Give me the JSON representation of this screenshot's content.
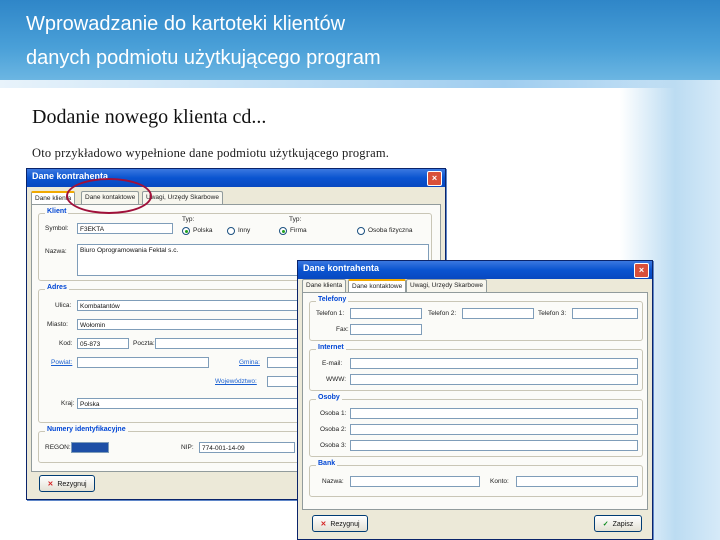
{
  "slide": {
    "title_line1": "Wprowadzanie do kartoteki klientów",
    "title_line2": "danych podmiotu użytkującego program",
    "subheading": "Dodanie nowego klienta cd...",
    "caption": "Oto przykładowo wypełnione dane podmiotu użytkującego program."
  },
  "colors": {
    "header_blue": "#2f86c8",
    "titlebar_blue": "#0a54d0",
    "highlight": "#a0103a",
    "group_label": "#0046d5"
  },
  "window_back": {
    "title": "Dane kontrahenta",
    "close_icon": "×",
    "tabs": [
      "Dane klienta",
      "Dane kontaktowe",
      "Uwagi, Urzędy Skarbowe"
    ],
    "group_klient": {
      "label": "Klient",
      "symbol_label": "Symbol:",
      "symbol_value": "F3EKTA",
      "typ_label": "Typ:",
      "typ_options": [
        "Polska",
        "Inny"
      ],
      "typ2_label": "Typ:",
      "typ2_options": [
        "Firma",
        "Osoba fizyczna"
      ],
      "nazwa_label": "Nazwa:",
      "nazwa_value": "Biuro Oprogramowania Fektal s.c."
    },
    "group_adres": {
      "label": "Adres",
      "ulica_label": "Ulica:",
      "ulica_value": "Kombatantów",
      "miasto_label": "Miasto:",
      "miasto_value": "Wołomin",
      "kod_label": "Kod:",
      "kod_value": "05-873",
      "poczta_label": "Poczta:",
      "powiat_label": "Powiat:",
      "gmina_label": "Gmina:",
      "wojewodztwo_label": "Województwo:",
      "kraj_label": "Kraj:",
      "kraj_value": "Polska"
    },
    "group_numery": {
      "label": "Numery identyfikacyjne",
      "regon_label": "REGON:",
      "nip_label": "NIP:",
      "nip_value": "774-001-14-09"
    },
    "cancel_button": "Rezygnuj",
    "cancel_icon": "x-icon"
  },
  "window_front": {
    "title": "Dane kontrahenta",
    "close_icon": "×",
    "tabs": [
      "Dane klienta",
      "Dane kontaktowe",
      "Uwagi, Urzędy Skarbowe"
    ],
    "group_telefony": {
      "label": "Telefony",
      "telefon1_label": "Telefon 1:",
      "telefon2_label": "Telefon 2:",
      "telefon3_label": "Telefon 3:",
      "fax_label": "Fax:"
    },
    "group_internet": {
      "label": "Internet",
      "email_label": "E-mail:",
      "www_label": "WWW:"
    },
    "group_osoby": {
      "label": "Osoby",
      "osoba1_label": "Osoba 1:",
      "osoba2_label": "Osoba 2:",
      "osoba3_label": "Osoba 3:"
    },
    "group_bank": {
      "label": "Bank",
      "nazwa_label": "Nazwa:",
      "konto_label": "Konto:"
    },
    "cancel_button": "Rezygnuj",
    "save_button": "Zapisz"
  }
}
